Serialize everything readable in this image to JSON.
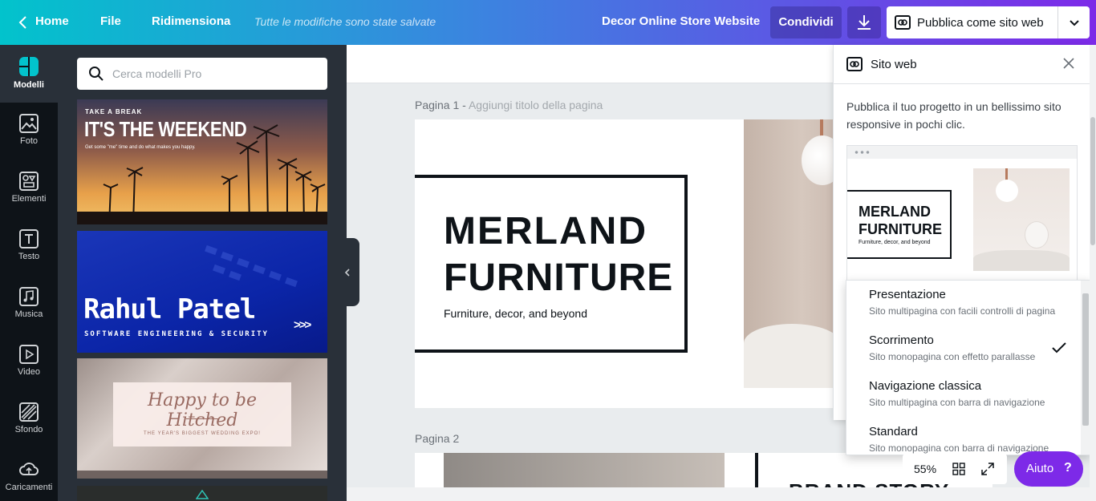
{
  "topbar": {
    "home": "Home",
    "file": "File",
    "resize": "Ridimensiona",
    "saved_status": "Tutte le modifiche sono state salvate",
    "project_title": "Decor Online Store Website",
    "share": "Condividi",
    "publish": "Pubblica come sito web"
  },
  "sidebar": {
    "items": [
      {
        "label": "Modelli",
        "icon": "templates-icon"
      },
      {
        "label": "Foto",
        "icon": "photo-icon"
      },
      {
        "label": "Elementi",
        "icon": "elements-icon"
      },
      {
        "label": "Testo",
        "icon": "text-icon"
      },
      {
        "label": "Musica",
        "icon": "music-icon"
      },
      {
        "label": "Video",
        "icon": "video-icon"
      },
      {
        "label": "Sfondo",
        "icon": "background-icon"
      },
      {
        "label": "Caricamenti",
        "icon": "upload-icon"
      }
    ]
  },
  "panel": {
    "search_placeholder": "Cerca modelli Pro",
    "templates": [
      {
        "kicker": "TAKE A BREAK",
        "title": "IT'S THE WEEKEND",
        "subtitle": "Get some \"me\" time and do what makes you happy."
      },
      {
        "title": "Rahul Patel",
        "subtitle": "SOFTWARE ENGINEERING & SECURITY",
        "arrows": ">>>"
      },
      {
        "title": "Happy to be Hitched",
        "subtitle": "THE YEAR'S BIGGEST WEDDING EXPO!"
      }
    ]
  },
  "canvas": {
    "page1_label": "Pagina 1 -",
    "page1_title_placeholder": "Aggiungi titolo della pagina",
    "page1": {
      "title_line1": "MERLAND",
      "title_line2": "FURNITURE",
      "tagline": "Furniture, decor, and beyond"
    },
    "page2_label": "Pagina 2",
    "page2": {
      "heading": "BRAND STORY"
    }
  },
  "website_panel": {
    "title": "Sito web",
    "description": "Pubblica il tuo progetto in un bellissimo sito responsive in pochi clic.",
    "preview": {
      "title_line1": "MERLAND",
      "title_line2": "FURNITURE",
      "tagline": "Furniture, decor, and beyond"
    },
    "options": [
      {
        "title": "Presentazione",
        "desc": "Sito multipagina con facili controlli di pagina",
        "selected": false
      },
      {
        "title": "Scorrimento",
        "desc": "Sito monopagina con effetto parallasse",
        "selected": true
      },
      {
        "title": "Navigazione classica",
        "desc": "Sito multipagina con barra di navigazione",
        "selected": false
      },
      {
        "title": "Standard",
        "desc": "Sito monopagina con barra di navigazione",
        "selected": false
      }
    ]
  },
  "bottom": {
    "zoom": "55%",
    "help": "Aiuto",
    "help_icon": "?"
  },
  "colors": {
    "accent": "#7d2ae8",
    "sidebar_bg": "#0e1318",
    "panel_bg": "#293039",
    "teal": "#02c3cc"
  }
}
